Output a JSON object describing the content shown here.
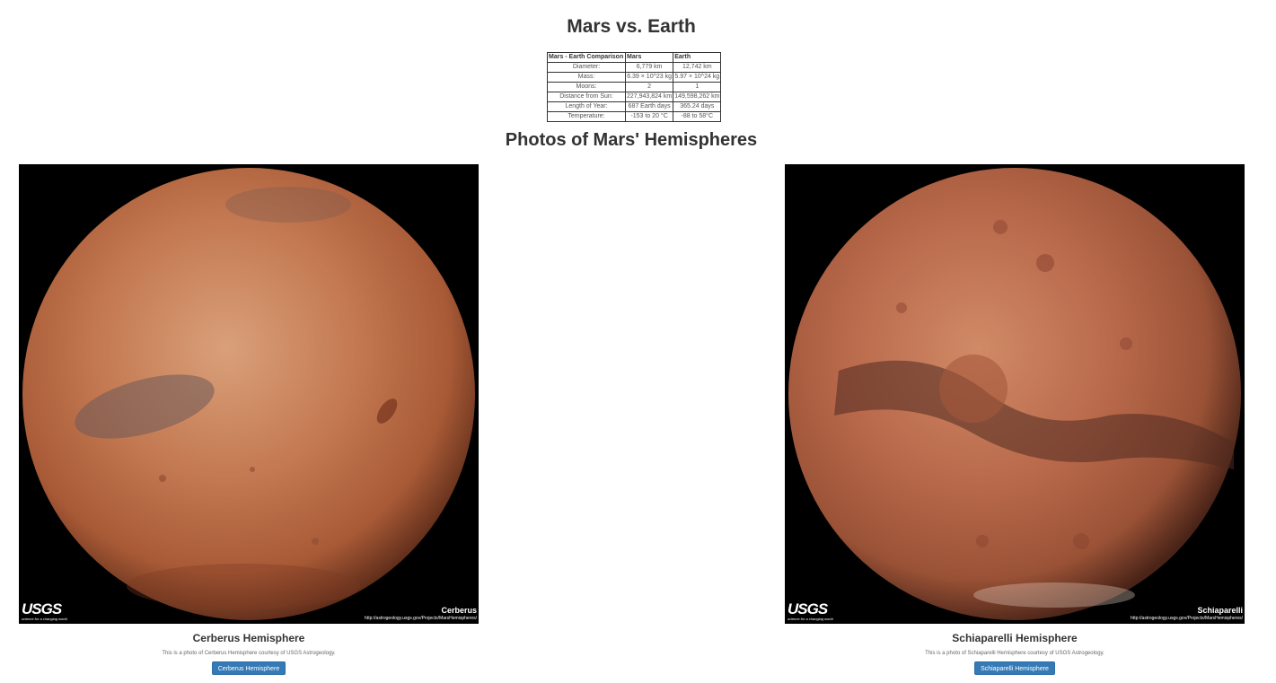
{
  "header": {
    "title": "Mars vs. Earth"
  },
  "facts_table": {
    "headers": [
      "Mars - Earth Comparison",
      "Mars",
      "Earth"
    ],
    "rows": [
      {
        "label": "Diameter:",
        "mars": "6,779 km",
        "earth": "12,742 km"
      },
      {
        "label": "Mass:",
        "mars": "6.39 × 10^23 kg",
        "earth": "5.97 × 10^24 kg"
      },
      {
        "label": "Moons:",
        "mars": "2",
        "earth": "1"
      },
      {
        "label": "Distance from Sun:",
        "mars": "227,943,824 km",
        "earth": "149,598,262 km"
      },
      {
        "label": "Length of Year:",
        "mars": "687 Earth days",
        "earth": "365.24 days"
      },
      {
        "label": "Temperature:",
        "mars": "-153 to 20 °C",
        "earth": "-88 to 58°C"
      }
    ]
  },
  "hemispheres": {
    "heading": "Photos of Mars' Hemispheres",
    "items": [
      {
        "title": "Cerberus Hemisphere",
        "description": "This is a photo of Cerberus Hemisphere courtesy of USGS Astrogeology.",
        "button_label": "Cerberus Hemisphere",
        "image_label": "Cerberus",
        "image_url_text": "http://astrogeology.usgs.gov/Projects/MarsHemispheres/",
        "logo_text": "USGS",
        "logo_tagline": "science for a changing world"
      },
      {
        "title": "Schiaparelli Hemisphere",
        "description": "This is a photo of Schiaparelli Hemisphere courtesy of USGS Astrogeology.",
        "button_label": "Schiaparelli Hemisphere",
        "image_label": "Schiaparelli",
        "image_url_text": "http://astrogeology.usgs.gov/Projects/MarsHemispheres/",
        "logo_text": "USGS",
        "logo_tagline": "science for a changing world"
      }
    ]
  },
  "colors": {
    "button_bg": "#337ab7",
    "mars_light": "#d49a72",
    "mars_mid": "#b86a45",
    "mars_dark": "#5a2a18"
  }
}
